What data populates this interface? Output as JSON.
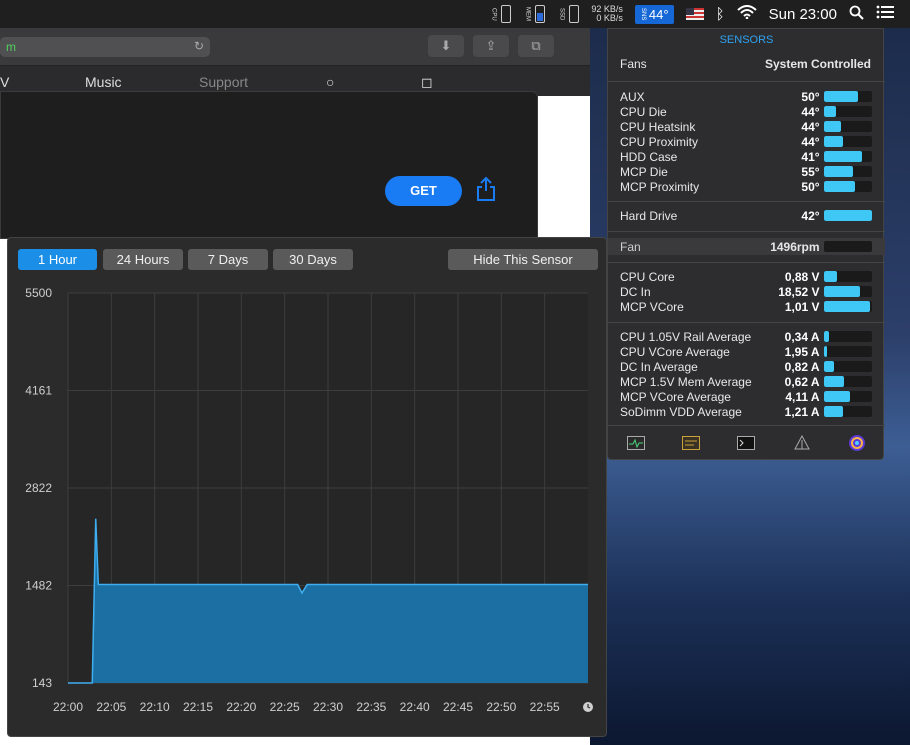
{
  "menubar": {
    "net_up": "92 KB/s",
    "net_down": "0 KB/s",
    "temp": "44°",
    "clock": "Sun 23:00"
  },
  "safari": {
    "url_tail": "m",
    "tabs": [
      "V",
      "Music",
      "Support"
    ],
    "get_label": "GET"
  },
  "chart_window": {
    "tabs": [
      "1 Hour",
      "24 Hours",
      "7 Days",
      "30 Days"
    ],
    "active_tab": "1 Hour",
    "hide_button": "Hide This Sensor"
  },
  "chart_data": {
    "type": "area",
    "ylim": [
      143,
      5500
    ],
    "yticks": [
      "5500",
      "4161",
      "2822",
      "1482",
      "143"
    ],
    "xticks": [
      "22:00",
      "22:05",
      "22:10",
      "22:15",
      "22:20",
      "22:25",
      "22:30",
      "22:35",
      "22:40",
      "22:45",
      "22:50",
      "22:55"
    ],
    "x_minutes": [
      0,
      2.8,
      3.2,
      3.5,
      10,
      20,
      26.5,
      27,
      27.6,
      30,
      40,
      50,
      60
    ],
    "values": [
      143,
      143,
      2400,
      1496,
      1496,
      1496,
      1496,
      1380,
      1496,
      1496,
      1496,
      1496,
      1496
    ],
    "grid": true,
    "color": "#1b6fa3",
    "line_color": "#3eaef0"
  },
  "sensors": {
    "title": "SENSORS",
    "fans_label": "Fans",
    "fans_value": "System Controlled",
    "temps": [
      {
        "label": "AUX",
        "value": "50°",
        "level": 0.72
      },
      {
        "label": "CPU Die",
        "value": "44°",
        "level": 0.25
      },
      {
        "label": "CPU Heatsink",
        "value": "44°",
        "level": 0.35
      },
      {
        "label": "CPU Proximity",
        "value": "44°",
        "level": 0.4
      },
      {
        "label": "HDD Case",
        "value": "41°",
        "level": 0.8
      },
      {
        "label": "MCP Die",
        "value": "55°",
        "level": 0.6
      },
      {
        "label": "MCP Proximity",
        "value": "50°",
        "level": 0.65
      }
    ],
    "drive": {
      "label": "Hard Drive",
      "value": "42°",
      "level": 1.0
    },
    "fan": {
      "label": "Fan",
      "value": "1496rpm",
      "level": 0.0
    },
    "voltages": [
      {
        "label": "CPU Core",
        "value": "0,88 V",
        "level": 0.27
      },
      {
        "label": "DC In",
        "value": "18,52 V",
        "level": 0.75
      },
      {
        "label": "MCP VCore",
        "value": "1,01 V",
        "level": 0.95
      }
    ],
    "currents": [
      {
        "label": "CPU 1.05V Rail Average",
        "value": "0,34 A",
        "level": 0.12
      },
      {
        "label": "CPU VCore Average",
        "value": "1,95 A",
        "level": 0.08
      },
      {
        "label": "DC In Average",
        "value": "0,82 A",
        "level": 0.22
      },
      {
        "label": "MCP 1.5V Mem Average",
        "value": "0,62 A",
        "level": 0.42
      },
      {
        "label": "MCP VCore Average",
        "value": "4,11 A",
        "level": 0.55
      },
      {
        "label": "SoDimm VDD Average",
        "value": "1,21 A",
        "level": 0.4
      }
    ],
    "footer_icons": [
      "activity-monitor-icon",
      "console-icon",
      "terminal-icon",
      "network-icon",
      "istat-icon"
    ]
  }
}
